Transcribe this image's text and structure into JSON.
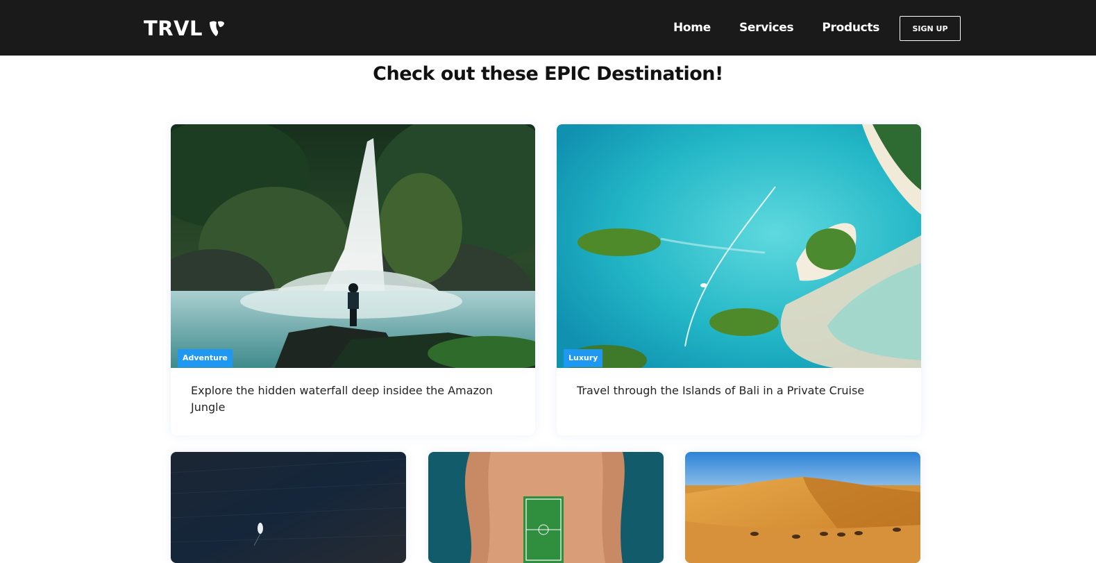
{
  "navbar": {
    "logo_text": "TRVL",
    "logo_icon": "typo3-logo-icon",
    "links": [
      {
        "label": "Home"
      },
      {
        "label": "Services"
      },
      {
        "label": "Products"
      }
    ],
    "signup_label": "SIGN UP"
  },
  "page": {
    "heading": "Check out these EPIC Destination!"
  },
  "cards": [
    {
      "tag": "Adventure",
      "title": "Explore the hidden waterfall deep insidee the Amazon Jungle",
      "image": "waterfall-jungle-photo"
    },
    {
      "tag": "Luxury",
      "title": "Travel through the Islands of Bali in a Private Cruise",
      "image": "bali-islands-aerial-photo"
    },
    {
      "image": "ocean-boat-aerial-photo"
    },
    {
      "image": "island-football-field-photo"
    },
    {
      "image": "desert-camel-caravan-photo"
    }
  ],
  "colors": {
    "navbar_bg": "#1b1a1a",
    "tag_bg": "#1f98f4",
    "page_bg": "#ffffff"
  }
}
